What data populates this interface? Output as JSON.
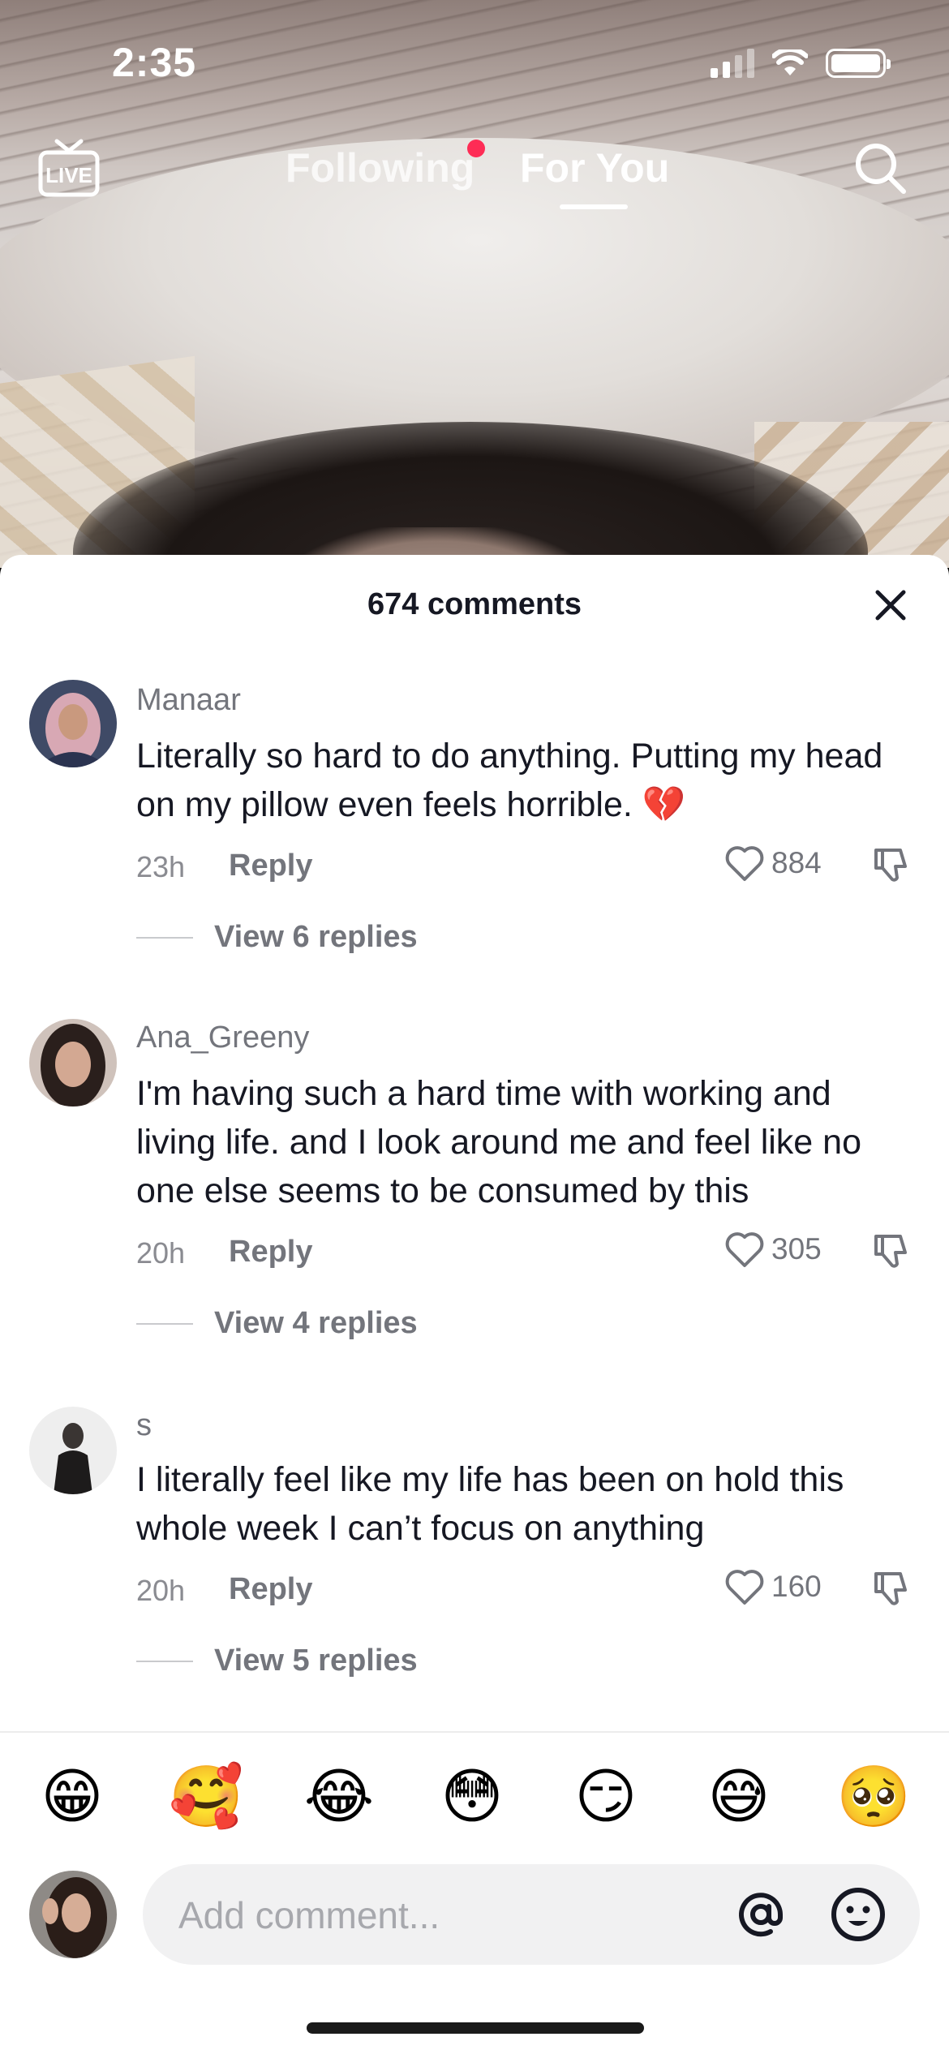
{
  "status_bar": {
    "time": "2:35"
  },
  "top_nav": {
    "live_label": "LIVE",
    "following_label": "Following",
    "for_you_label": "For You"
  },
  "comments_sheet": {
    "title": "674 comments",
    "comments": [
      {
        "username": "Manaar",
        "text": "Literally so hard to do anything. Putting my head on my pillow even feels horrible. 💔",
        "time": "23h",
        "reply_label": "Reply",
        "likes": "884",
        "view_replies": "View 6 replies"
      },
      {
        "username": "Ana_Greeny",
        "text": "I'm having such a hard time with working and living life. and I look around me and feel like no one else seems to be consumed by this",
        "time": "20h",
        "reply_label": "Reply",
        "likes": "305",
        "view_replies": "View 4 replies"
      },
      {
        "username": "s",
        "text": "I literally feel like my life has been on hold this whole week I can’t focus on anything",
        "time": "20h",
        "reply_label": "Reply",
        "likes": "160",
        "view_replies": "View 5 replies"
      }
    ]
  },
  "emoji_bar": [
    "😁",
    "🥰",
    "😂",
    "😳",
    "😏",
    "😅",
    "🥺"
  ],
  "comment_input": {
    "placeholder": "Add comment..."
  },
  "colors": {
    "accent_dot": "#fe2c55",
    "text_primary": "#161823",
    "text_secondary": "#73757c",
    "input_bg": "#f1f1f2"
  }
}
